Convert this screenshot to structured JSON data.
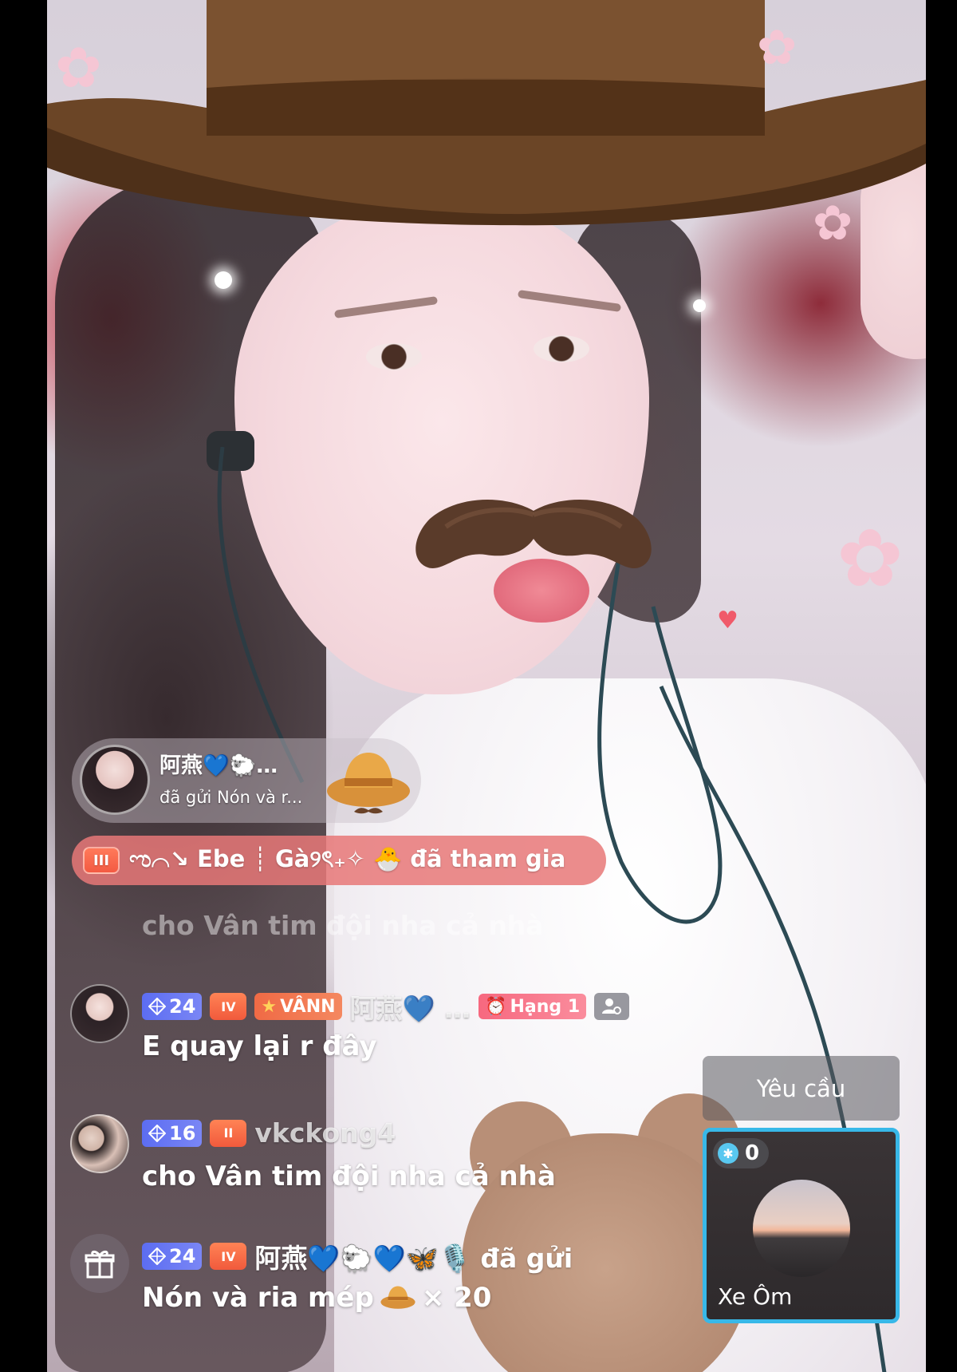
{
  "gift_banner": {
    "user": "阿燕💙🐑…",
    "description": "đã gửi Nón và r..."
  },
  "join_notice": {
    "level": "III",
    "text": "ಌ⌒↘ Ebe ┊ Gà୨ৎ₊✧ 🐣 đã tham gia"
  },
  "faded_message": "cho Vân tim đội nha cả nhà",
  "chat": [
    {
      "level": "24",
      "fan_level": "IV",
      "club": "VÂNN",
      "name": "阿燕💙 …",
      "rank": "Hạng 1",
      "text": "E quay lại r đây"
    },
    {
      "level": "16",
      "fan_level": "II",
      "name": "vkckong4",
      "text": "cho Vân tim đội nha cả nhà"
    },
    {
      "level": "24",
      "fan_level": "IV",
      "name": "阿燕💙🐑💙🦋🎙️ đã gửi",
      "text_prefix": "Nón và ria mép",
      "text_suffix": "× 20"
    }
  ],
  "request_button": "Yêu cầu",
  "guest": {
    "score": "0",
    "name": "Xe Ôm"
  },
  "icons": {
    "gift": "gift-icon",
    "diamond": "diamond-icon",
    "rank": "rank-icon",
    "group": "group-icon",
    "hat_gift": "cowboy-hat-gift-icon"
  }
}
